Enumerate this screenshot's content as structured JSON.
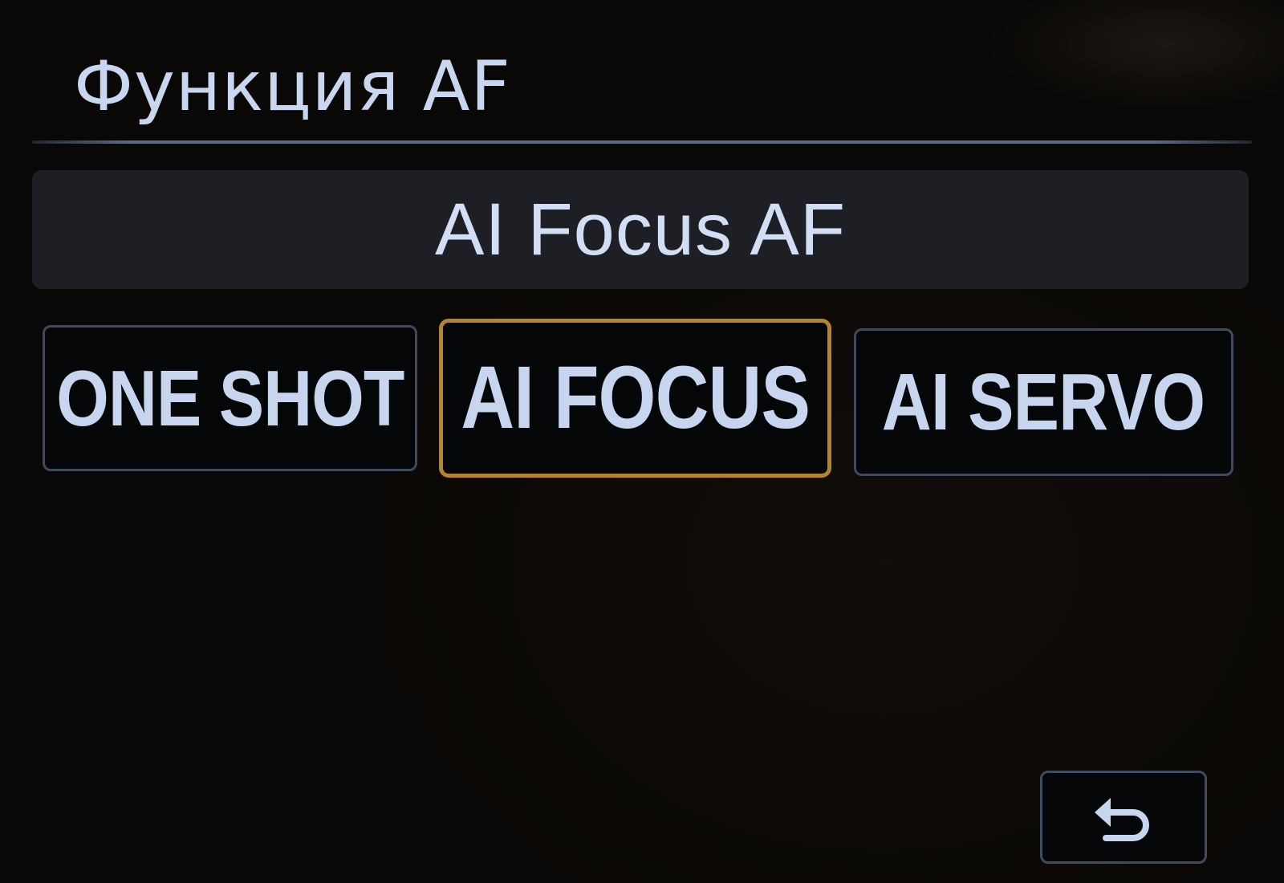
{
  "header": {
    "title": "Функция AF"
  },
  "current_mode": {
    "label": "AI Focus AF"
  },
  "mode_options": [
    {
      "label": "ONE SHOT",
      "selected": false
    },
    {
      "label": "AI FOCUS",
      "selected": true
    },
    {
      "label": "AI SERVO",
      "selected": false
    }
  ],
  "back_button": {
    "icon": "return-arrow-icon"
  },
  "colors": {
    "text": "#cfdcf3",
    "selection_border": "#b5852c",
    "option_border": "#3f4a5e",
    "mode_bar_background": "#1d1f24",
    "divider": "#5d6b84"
  }
}
